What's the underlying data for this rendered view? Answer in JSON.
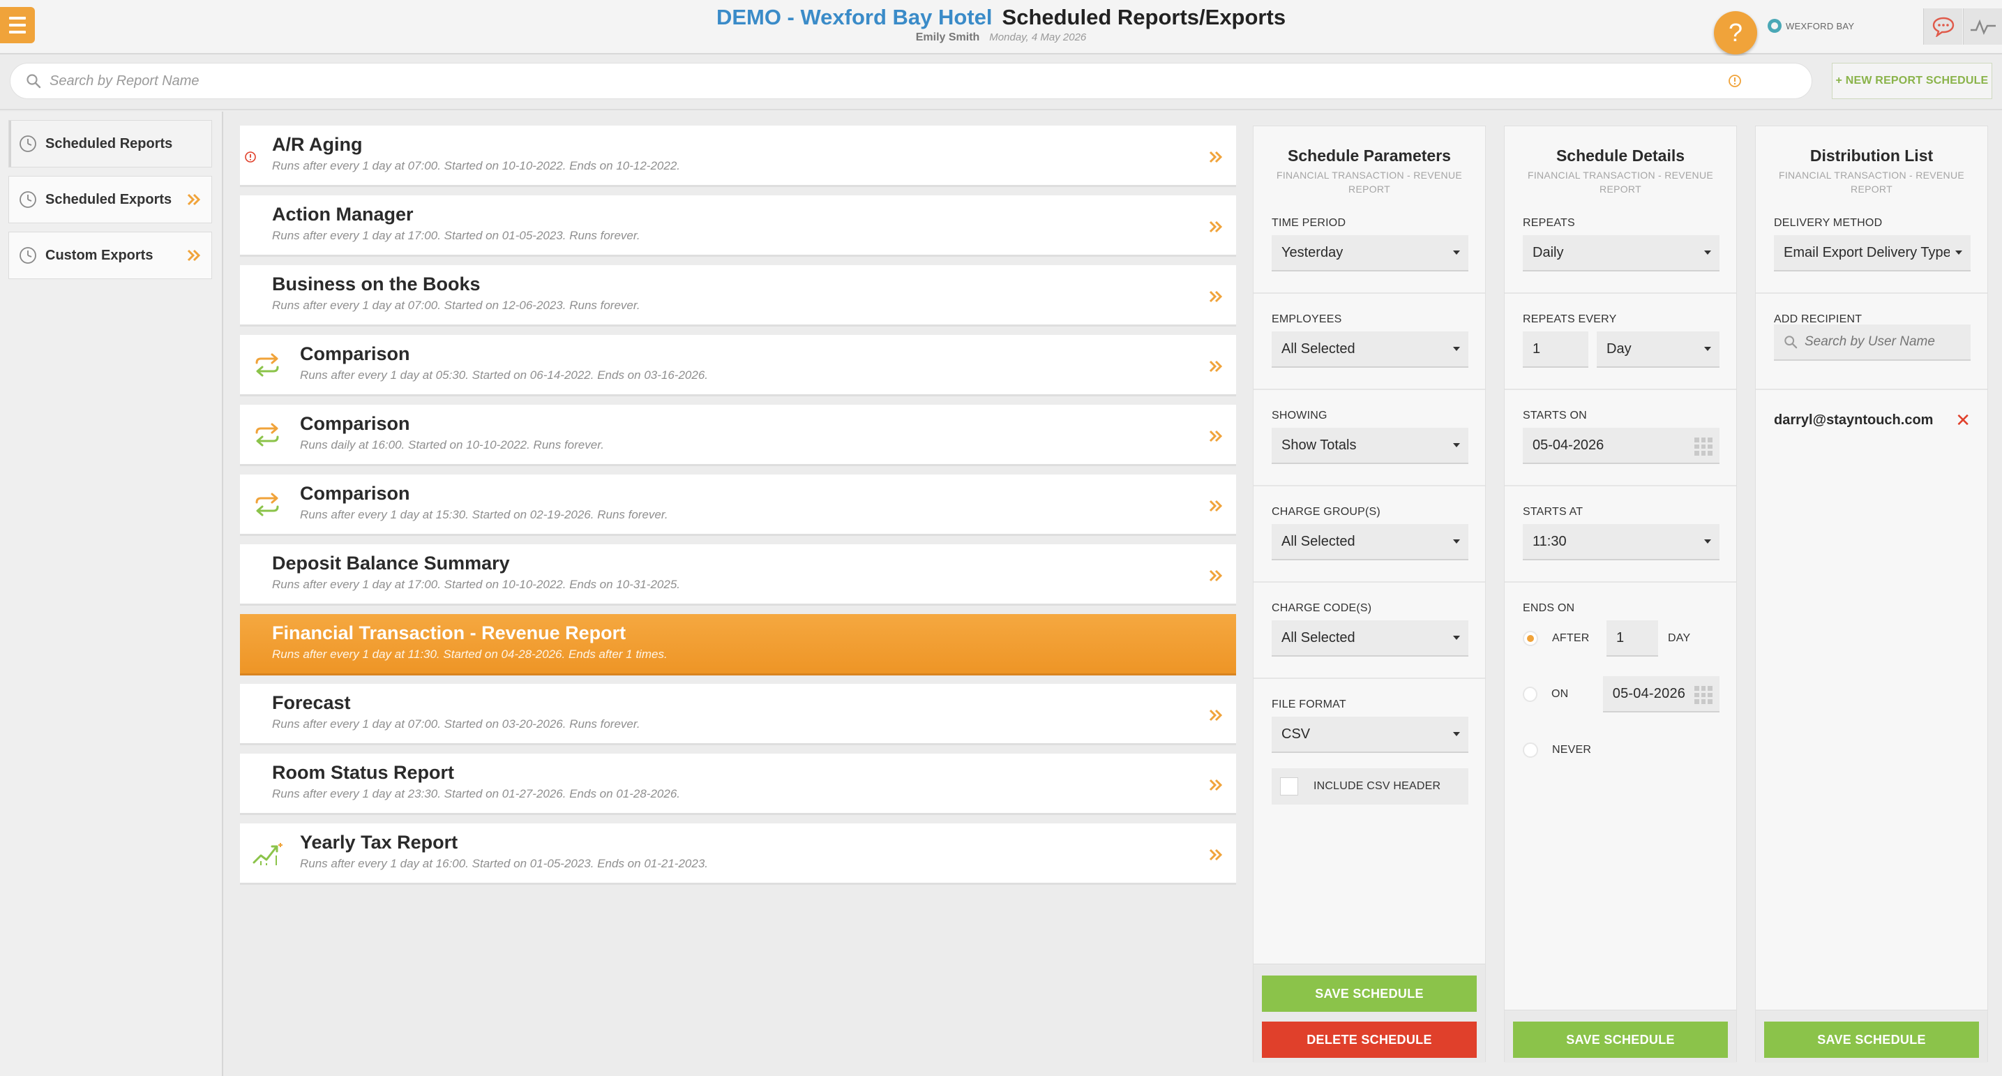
{
  "header": {
    "hotel_name": "DEMO - Wexford Bay Hotel",
    "page_title": "Scheduled Reports/Exports",
    "user_name": "Emily Smith",
    "date": "Monday, 4 May 2026",
    "help_symbol": "?",
    "brand_label": "WEXFORD BAY",
    "icons": [
      "menu-icon",
      "help-icon",
      "chat-icon",
      "activity-icon"
    ]
  },
  "search": {
    "placeholder": "Search by Report Name",
    "new_button": "+ NEW REPORT SCHEDULE"
  },
  "sidebar": {
    "items": [
      {
        "label": "Scheduled Reports",
        "active": true
      },
      {
        "label": "Scheduled Exports",
        "active": false
      },
      {
        "label": "Custom Exports",
        "active": false
      }
    ]
  },
  "reports": [
    {
      "name": "A/R Aging",
      "desc": "Runs after every 1 day at 07:00. Started on 10-10-2022. Ends on 10-12-2022.",
      "icon": "info-icon"
    },
    {
      "name": "Action Manager",
      "desc": "Runs after every 1 day at 17:00. Started on 01-05-2023. Runs forever.",
      "icon": ""
    },
    {
      "name": "Business on the Books",
      "desc": "Runs after every 1 day at 07:00. Started on 12-06-2023. Runs forever.",
      "icon": ""
    },
    {
      "name": "Comparison",
      "desc": "Runs after every 1 day at 05:30. Started on 06-14-2022. Ends on 03-16-2026.",
      "icon": "compare-icon"
    },
    {
      "name": "Comparison",
      "desc": "Runs daily at 16:00. Started on 10-10-2022. Runs forever.",
      "icon": "compare-icon"
    },
    {
      "name": "Comparison",
      "desc": "Runs after every 1 day at 15:30. Started on 02-19-2026. Runs forever.",
      "icon": "compare-icon"
    },
    {
      "name": "Deposit Balance Summary",
      "desc": "Runs after every 1 day at 17:00. Started on 10-10-2022. Ends on 10-31-2025.",
      "icon": ""
    },
    {
      "name": "Financial Transaction - Revenue Report",
      "desc": "Runs after every 1 day at 11:30. Started on 04-28-2026. Ends after 1 times.",
      "icon": "",
      "active": true
    },
    {
      "name": "Forecast",
      "desc": "Runs after every 1 day at 07:00. Started on 03-20-2026. Runs forever.",
      "icon": ""
    },
    {
      "name": "Room Status Report",
      "desc": "Runs after every 1 day at 23:30. Started on 01-27-2026. Ends on 01-28-2026.",
      "icon": ""
    },
    {
      "name": "Yearly Tax Report",
      "desc": "Runs after every 1 day at 16:00. Started on 01-05-2023. Ends on 01-21-2023.",
      "icon": "trend-icon"
    }
  ],
  "params": {
    "title": "Schedule Parameters",
    "subtitle": "FINANCIAL TRANSACTION - REVENUE REPORT",
    "time_period_label": "TIME PERIOD",
    "time_period_value": "Yesterday",
    "employees_label": "EMPLOYEES",
    "employees_value": "All Selected",
    "showing_label": "SHOWING",
    "showing_value": "Show Totals",
    "charge_groups_label": "CHARGE GROUP(S)",
    "charge_groups_value": "All Selected",
    "charge_codes_label": "CHARGE CODE(S)",
    "charge_codes_value": "All Selected",
    "file_format_label": "FILE FORMAT",
    "file_format_value": "CSV",
    "csv_header_label": "INCLUDE CSV HEADER",
    "save_label": "SAVE SCHEDULE",
    "delete_label": "DELETE SCHEDULE"
  },
  "details": {
    "title": "Schedule Details",
    "subtitle": "FINANCIAL TRANSACTION - REVENUE REPORT",
    "repeats_label": "REPEATS",
    "repeats_value": "Daily",
    "repeats_every_label": "REPEATS EVERY",
    "repeats_every_num": "1",
    "repeats_every_unit": "Day",
    "starts_on_label": "STARTS ON",
    "starts_on_value": "05-04-2026",
    "starts_at_label": "STARTS AT",
    "starts_at_value": "11:30",
    "ends_on_label": "ENDS ON",
    "after_label": "AFTER",
    "after_value": "1",
    "after_unit": "DAY",
    "on_label": "ON",
    "on_value": "05-04-2026",
    "never_label": "NEVER",
    "save_label": "SAVE SCHEDULE"
  },
  "distribution": {
    "title": "Distribution List",
    "subtitle": "FINANCIAL TRANSACTION - REVENUE REPORT",
    "delivery_label": "DELIVERY METHOD",
    "delivery_value": "Email Export Delivery Type",
    "add_recipient_label": "ADD RECIPIENT",
    "recipient_placeholder": "Search by User Name",
    "recipient_email": "darryl@stayntouch.com",
    "remove_symbol": "✕",
    "save_label": "SAVE SCHEDULE"
  },
  "colors": {
    "accent_orange": "#f0a33a",
    "hotel_blue": "#3a8bc8",
    "save_green": "#8bc34a",
    "delete_red": "#e0402b"
  }
}
